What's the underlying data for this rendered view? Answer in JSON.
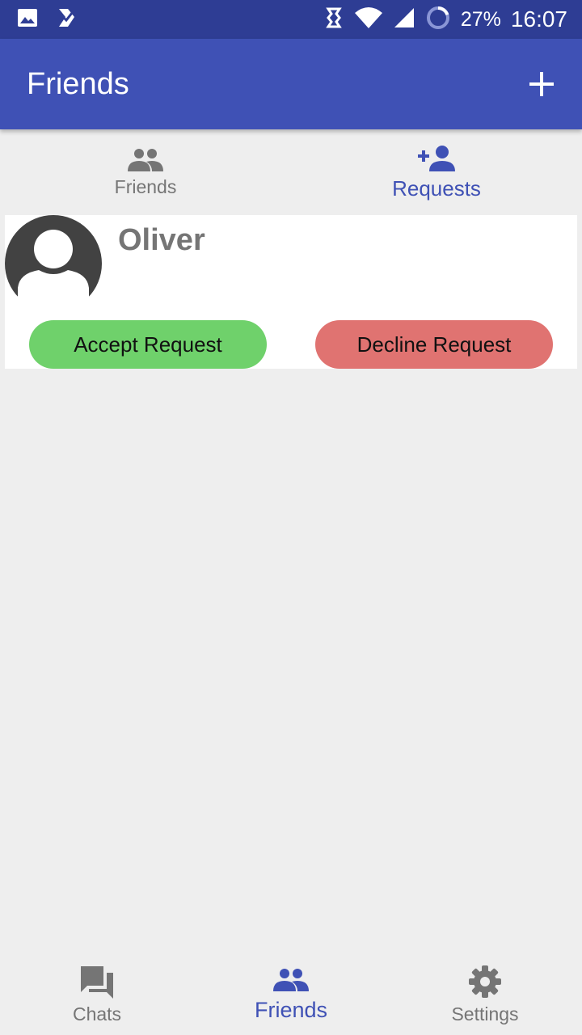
{
  "status_bar": {
    "battery": "27%",
    "time": "16:07"
  },
  "app_bar": {
    "title": "Friends",
    "add_icon": "plus-icon"
  },
  "top_tabs": [
    {
      "label": "Friends",
      "icon": "people-icon",
      "active": false
    },
    {
      "label": "Requests",
      "icon": "person-add-icon",
      "active": true
    }
  ],
  "request": {
    "name": "Oliver",
    "accept_label": "Accept Request",
    "decline_label": "Decline Request"
  },
  "bottom_nav": [
    {
      "label": "Chats",
      "icon": "chat-icon",
      "active": false
    },
    {
      "label": "Friends",
      "icon": "people-icon",
      "active": true
    },
    {
      "label": "Settings",
      "icon": "gear-icon",
      "active": false
    }
  ],
  "colors": {
    "primary": "#3f51b5",
    "status_bar": "#2e3d94",
    "accept": "#6fd16b",
    "decline": "#e07371",
    "background": "#eeeeee"
  }
}
